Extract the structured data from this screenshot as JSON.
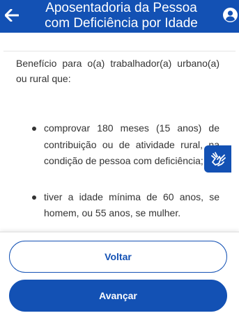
{
  "header": {
    "title": "Aposentadoria da Pessoa\ncom Deficiência por Idade",
    "back_icon": "arrow-left-icon",
    "account_icon": "user-circle-icon"
  },
  "content": {
    "intro": "Benefício para o(a) trabalhador(a) urbano(a) ou rural que:",
    "requirements": [
      "comprovar 180 meses (15 anos) de contribuição ou de atividade rural, na condição de pessoa com deficiência;",
      "tiver a idade mínima de 60 anos, se homem, ou 55 anos, se mulher."
    ]
  },
  "accessibility": {
    "libras_icon": "sign-language-hands-icon"
  },
  "footer": {
    "back_label": "Voltar",
    "next_label": "Avançar"
  },
  "colors": {
    "primary": "#1351b4",
    "text": "#333333",
    "background": "#ffffff"
  }
}
